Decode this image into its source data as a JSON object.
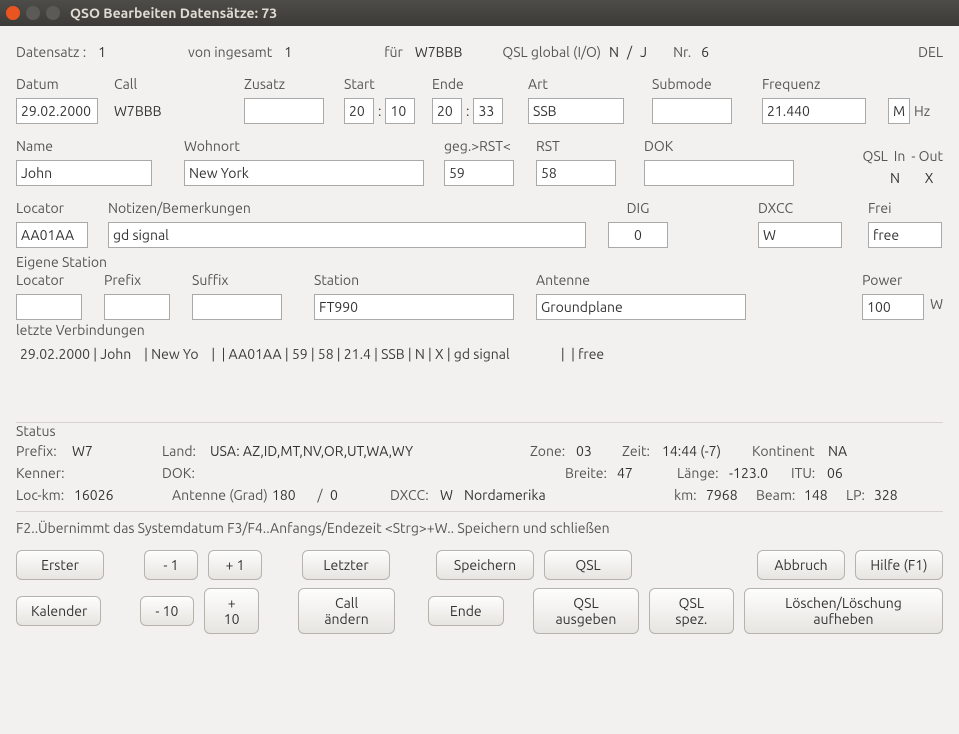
{
  "window": {
    "title": "QSO Bearbeiten  Datensätze: 73"
  },
  "top": {
    "datensatz_label": "Datensatz :",
    "datensatz_value": "1",
    "voninsgesamt_label": "von ingesamt",
    "voninsgesamt_value": "1",
    "fuer_label": "für",
    "fuer_value": "W7BBB",
    "qslglobal_label": "QSL global (I/O)",
    "qslglobal_i": "N",
    "qslglobal_sep": "/",
    "qslglobal_o": "J",
    "nr_label": "Nr.",
    "nr_value": "6",
    "del_label": "DEL"
  },
  "row1": {
    "datum_label": "Datum",
    "datum_value": "29.02.2000",
    "call_label": "Call",
    "call_value": "W7BBB",
    "zusatz_label": "Zusatz",
    "zusatz_value": "",
    "start_label": "Start",
    "start_h": "20",
    "start_m": "10",
    "ende_label": "Ende",
    "ende_h": "20",
    "ende_m": "33",
    "art_label": "Art",
    "art_value": "SSB",
    "submode_label": "Submode",
    "submode_value": "",
    "frequenz_label": "Frequenz",
    "frequenz_value": "21.440",
    "unit_value": "M",
    "hz_label": "Hz"
  },
  "row2": {
    "name_label": "Name",
    "name_value": "John",
    "wohnort_label": "Wohnort",
    "wohnort_value": "New York",
    "rstg_label": "geg.>RST<",
    "rstg_value": "59",
    "rst_label": "RST",
    "rst_value": "58",
    "dok_label": "DOK",
    "dok_value": "",
    "qsl_label": "QSL",
    "qsl_in_label": "In",
    "qsl_out_label": "- Out",
    "qsl_in_value": "N",
    "qsl_out_value": "X"
  },
  "row3": {
    "locator_label": "Locator",
    "locator_value": "AA01AA",
    "notizen_label": "Notizen/Bemerkungen",
    "notizen_value": "gd signal",
    "dig_label": "DIG",
    "dig_value": "0",
    "dxcc_label": "DXCC",
    "dxcc_value": "W",
    "frei_label": "Frei",
    "frei_value": "free"
  },
  "own": {
    "title": "Eigene Station",
    "locator_label": "Locator",
    "locator_value": "",
    "prefix_label": "Prefix",
    "prefix_value": "",
    "suffix_label": "Suffix",
    "suffix_value": "",
    "station_label": "Station",
    "station_value": "FT990",
    "antenne_label": "Antenne",
    "antenne_value": "Groundplane",
    "power_label": "Power",
    "power_value": "100",
    "power_unit": "W"
  },
  "last": {
    "title": "letzte Verbindungen",
    "line": "29.02.2000 | John    | New Yo    |  | AA01AA | 59 | 58 | 21.4 | SSB | N | X | gd signal                |  | free"
  },
  "status": {
    "title": "Status",
    "prefix_label": "Prefix:",
    "prefix_value": "W7",
    "land_label": "Land:",
    "land_value": "USA: AZ,ID,MT,NV,OR,UT,WA,WY",
    "zone_label": "Zone:",
    "zone_value": "03",
    "zeit_label": "Zeit:",
    "zeit_value": "14:44 (-7)",
    "kontinent_label": "Kontinent",
    "kontinent_value": "NA",
    "kenner_label": "Kenner:",
    "kenner_value": "",
    "dok_label": "DOK:",
    "dok_value": "",
    "breite_label": "Breite:",
    "breite_value": "47",
    "laenge_label": "Länge:",
    "laenge_value": "-123.0",
    "itu_label": "ITU:",
    "itu_value": "06",
    "lockm_label": "Loc-km:",
    "lockm_value": "16026",
    "antgrad_label": "Antenne (Grad)",
    "antgrad_v1": "180",
    "antgrad_sep": "/",
    "antgrad_v2": "0",
    "dxcc_label": "DXCC:",
    "dxcc_value": "W",
    "dxcc_region": "Nordamerika",
    "km_label": "km:",
    "km_value": "7968",
    "beam_label": "Beam:",
    "beam_value": "148",
    "lp_label": "LP:",
    "lp_value": "328"
  },
  "hint": "F2..Übernimmt das Systemdatum    F3/F4..Anfangs/Endezeit <Strg>+W.. Speichern und schließen",
  "buttons": {
    "erster": "Erster",
    "m1": "- 1",
    "p1": "+ 1",
    "letzter": "Letzter",
    "speichern": "Speichern",
    "qsl": "QSL",
    "abbruch": "Abbruch",
    "hilfe": "Hilfe (F1)",
    "kalender": "Kalender",
    "m10": "- 10",
    "p10": "+ 10",
    "callaendern": "Call ändern",
    "ende": "Ende",
    "qslausgeben": "QSL ausgeben",
    "qslspez": "QSL spez.",
    "loeschen": "Löschen/Löschung aufheben"
  }
}
